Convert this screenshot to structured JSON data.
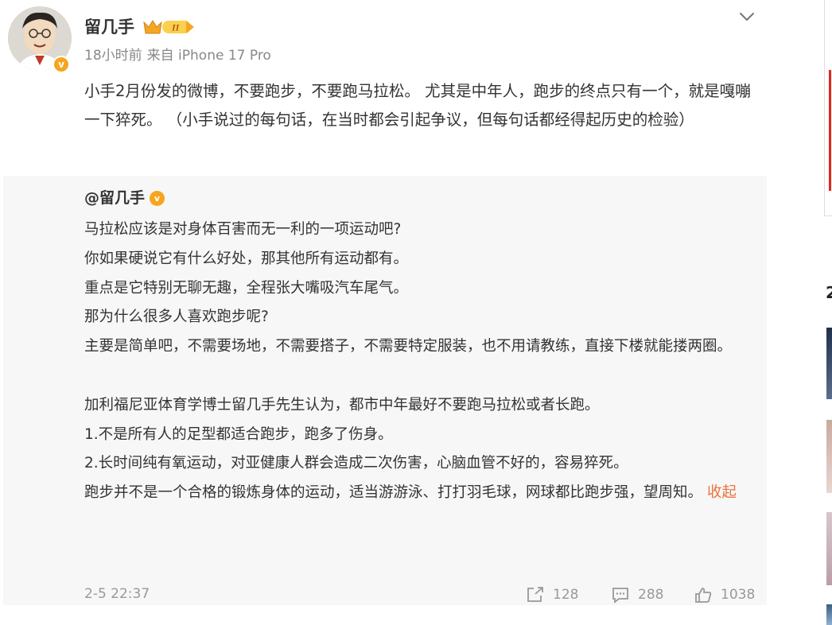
{
  "post": {
    "author": "留几手",
    "vip_level": "II",
    "time": "18小时前",
    "source": "来自 iPhone 17 Pro",
    "text": "小手2月份发的微博，不要跑步，不要跑马拉松。 尤其是中年人，跑步的终点只有一个，就是嘎嘣一下猝死。 （小手说过的每句话，在当时都会引起争议，但每句话都经得起历史的检验）",
    "menu_icon": "chevron-down-icon"
  },
  "repost": {
    "author": "@留几手",
    "lines": [
      "马拉松应该是对身体百害而无一利的一项运动吧?",
      "你如果硬说它有什么好处，那其他所有运动都有。",
      "重点是它特别无聊无趣，全程张大嘴吸汽车尾气。",
      "那为什么很多人喜欢跑步呢?",
      "主要是简单吧，不需要场地，不需要搭子，不需要特定服装，也不用请教练，直接下楼就能搂两圈。",
      "",
      "加利福尼亚体育学博士留几手先生认为，都市中年最好不要跑马拉松或者长跑。",
      "1.不是所有人的足型都适合跑步，跑多了伤身。",
      "2.长时间纯有氧运动，对亚健康人群会造成二次伤害，心脑血管不好的，容易猝死。",
      "跑步并不是一个合格的锻炼身体的运动，适当游游泳、打打羽毛球，网球都比跑步强，望周知。"
    ],
    "collapse_label": "收起",
    "date": "2-5 22:37",
    "shares": "128",
    "comments": "288",
    "likes": "1038"
  },
  "sidebar": {
    "rank_number": "2"
  },
  "colors": {
    "link": "#eb7340",
    "badge": "#f7a51e",
    "repost_bg": "#f7f7f7",
    "meta": "#888888"
  }
}
